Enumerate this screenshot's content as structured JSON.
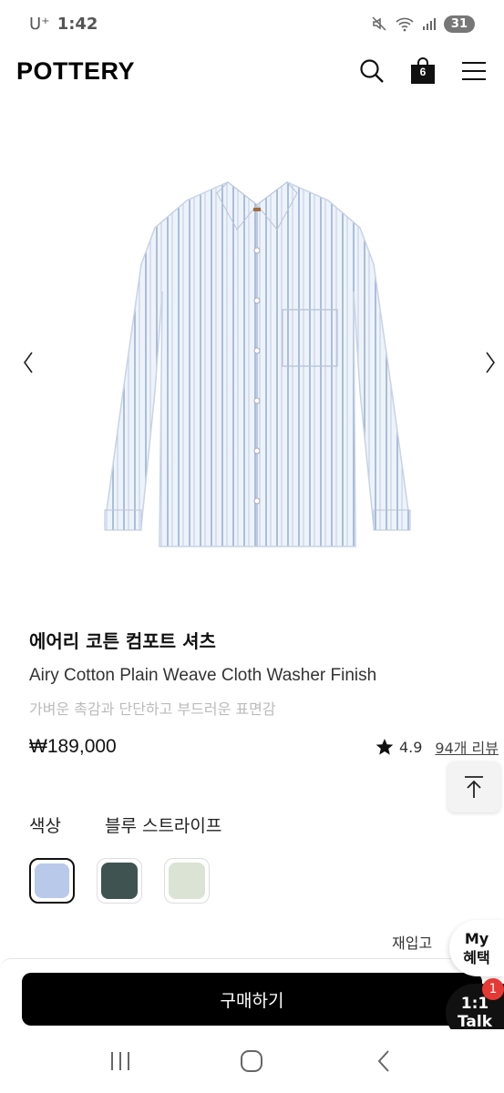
{
  "status_bar": {
    "carrier": "U⁺",
    "time": "1:42",
    "battery": "31"
  },
  "header": {
    "logo": "POTTERY",
    "cart_count": "6",
    "icons": [
      "search-icon",
      "shopping-bag-icon",
      "menu-icon"
    ]
  },
  "gallery": {
    "prev_icon": "chevron-left-icon",
    "next_icon": "chevron-right-icon"
  },
  "product": {
    "name_ko": "에어리 코튼 컴포트 셔츠",
    "name_en": "Airy Cotton Plain Weave Cloth Washer Finish",
    "description": "가벼운 촉감과 단단하고 부드러운 표면감",
    "price": "₩189,000",
    "rating": "4.9",
    "reviews": "94개 리뷰"
  },
  "options": {
    "color_label": "색상",
    "selected_color": "블루 스트라이프",
    "swatches": [
      "#b9c9ea",
      "#3f5350",
      "#dbe3d4"
    ]
  },
  "restock": "재입고 ",
  "floating": {
    "my_benefit_line1": "My",
    "my_benefit_line2": "혜택",
    "talk_line1": "1:1",
    "talk_line2": "Talk",
    "talk_badge": "1"
  },
  "actions": {
    "buy_label": "구매하기"
  },
  "colors": {
    "accent": "#000000",
    "badge": "#e53935"
  }
}
